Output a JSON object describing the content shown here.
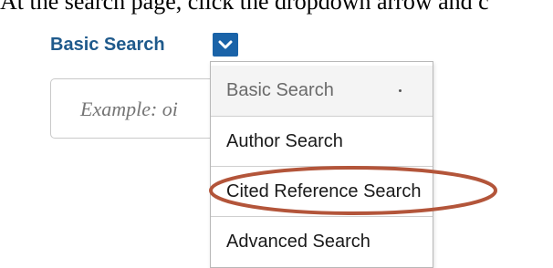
{
  "instruction": {
    "text": "At the search page, click the dropdown arrow and c"
  },
  "search": {
    "type_label": "Basic Search",
    "placeholder": "Example: oi",
    "dropdown_icon": "chevron-down-icon"
  },
  "menu": {
    "items": [
      {
        "label": "Basic Search",
        "selected": true
      },
      {
        "label": "Author Search"
      },
      {
        "label": "Cited Reference Search",
        "highlighted": true
      },
      {
        "label": "Advanced Search"
      }
    ]
  },
  "colors": {
    "accent": "#1a63a8",
    "label": "#1f5a8c",
    "highlight": "#b3553a"
  }
}
